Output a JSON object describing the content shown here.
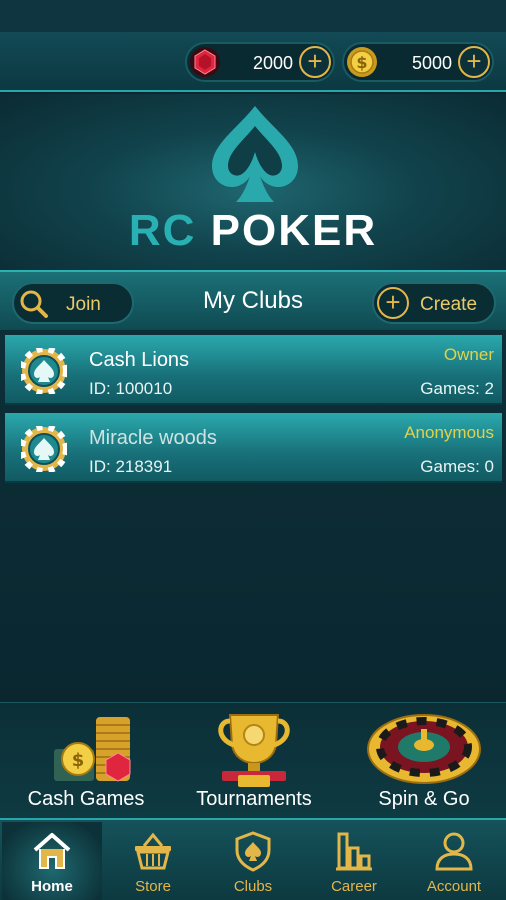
{
  "currency": {
    "gems": "2000",
    "coins": "5000"
  },
  "logo": {
    "rc": "RC",
    "poker": "POKER"
  },
  "clubs_bar": {
    "join_label": "Join",
    "title": "My Clubs",
    "create_label": "Create"
  },
  "clubs": [
    {
      "name": "Cash Lions",
      "id": "ID: 100010",
      "role": "Owner",
      "games": "Games: 2"
    },
    {
      "name": "Miracle woods",
      "id": "ID: 218391",
      "role": "Anonymous",
      "games": "Games: 0"
    }
  ],
  "modes": [
    {
      "label": "Cash Games"
    },
    {
      "label": "Tournaments"
    },
    {
      "label": "Spin & Go"
    }
  ],
  "nav": [
    {
      "label": "Home",
      "icon": "home-icon",
      "active": true
    },
    {
      "label": "Store",
      "icon": "basket-icon"
    },
    {
      "label": "Clubs",
      "icon": "shield-spade-icon"
    },
    {
      "label": "Career",
      "icon": "bar-chart-icon"
    },
    {
      "label": "Account",
      "icon": "user-icon"
    }
  ],
  "colors": {
    "accent_teal": "#29b0b3",
    "gold": "#e3b64a",
    "role_yellow": "#e1d24a",
    "background": "#0b2730"
  }
}
